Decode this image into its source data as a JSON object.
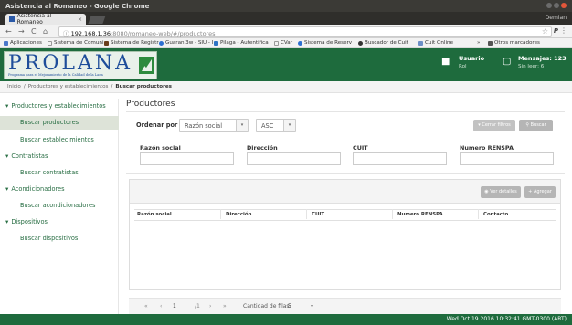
{
  "window": {
    "title": "Asistencia al Romaneo - Google Chrome",
    "tab_title": "Asistencia al Romaneo",
    "tab_close": "×",
    "profile_name": "Demian"
  },
  "addressbar": {
    "url_host": "192.168.1.36",
    "url_rest": ":8080/romaneo-web/#/productores",
    "back": "←",
    "forward": "→",
    "reload": "C",
    "home": "⌂",
    "info": "ⓘ",
    "star": "☆",
    "ext_label": "P",
    "menu": "⋮"
  },
  "bookmarks": {
    "items": [
      "Aplicaciones",
      "Sistema de Comuni",
      "Sistema de Registr",
      "Guaranı3w - SIU - I",
      "Pilaga - Autentifica",
      "CVar",
      "Sistema de Reserv",
      "Buscador de Cuit",
      "Cuit Online"
    ],
    "overflow": "»",
    "other": "Otros marcadores"
  },
  "header": {
    "logo": "PROLANA",
    "logo_sub": "Programa para el Mejoramiento de la Calidad de la Lana",
    "user_label": "Usuario",
    "user_role": "Rol",
    "messages_label": "Mensajes: 123",
    "messages_unread": "Sin leer: 6"
  },
  "breadcrumb": {
    "home": "Inicio",
    "sep": "/",
    "parent": "Productores y establecimientos",
    "current": "Buscar productores"
  },
  "sidebar": {
    "sections": [
      {
        "label": "Productores y establecimientos",
        "items": [
          "Buscar productores",
          "Buscar establecimientos"
        ]
      },
      {
        "label": "Contratistas",
        "items": [
          "Buscar contratistas"
        ]
      },
      {
        "label": "Acondicionadores",
        "items": [
          "Buscar acondicionadores"
        ]
      },
      {
        "label": "Dispositivos",
        "items": [
          "Buscar dispositivos"
        ]
      }
    ],
    "active_item": "Buscar productores",
    "toggle": "▾"
  },
  "main": {
    "title": "Productores",
    "sort": {
      "label": "Ordenar por",
      "field": "Razón social",
      "direction": "ASC",
      "caret": "▾"
    },
    "buttons": {
      "close_filters": "Cerrar filtros",
      "search": "Buscar",
      "details": "Ver detalles",
      "add": "Agregar"
    },
    "filters": [
      "Razón social",
      "Dirección",
      "CUIT",
      "Numero RENSPA"
    ],
    "table": {
      "columns": [
        "Razón social",
        "Dirección",
        "CUIT",
        "Numero RENSPA",
        "Contacto"
      ]
    },
    "pager": {
      "first": "«",
      "prev": "‹",
      "page": "1",
      "of": "/1",
      "next": "›",
      "last": "»",
      "rows_label": "Cantidad de filas",
      "rows_value": "5",
      "caret": "▾"
    }
  },
  "taskbar": {
    "clock": "Wed Oct 19 2016 10:32:41 GMT-0300 (ART)"
  },
  "colors": {
    "brand_green": "#1e6b3d",
    "link_green": "#2a6f45",
    "button_gray": "#b5b5b5"
  }
}
